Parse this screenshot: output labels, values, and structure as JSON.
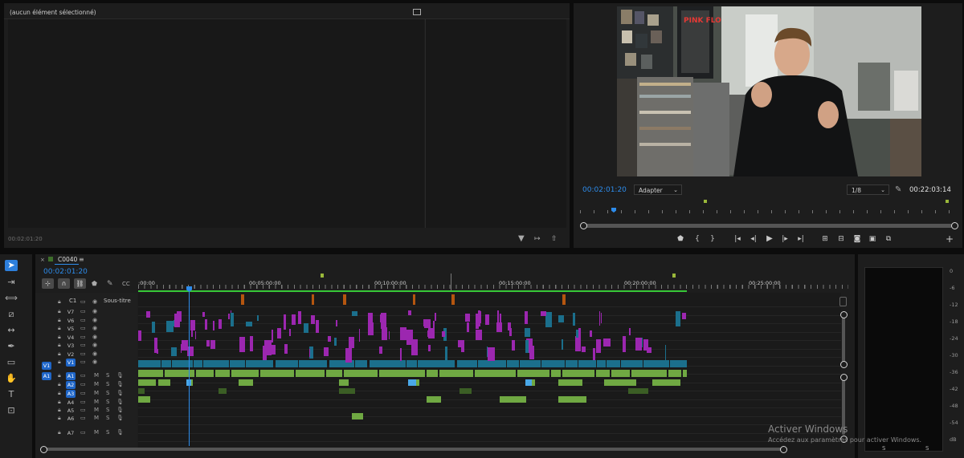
{
  "effect_controls": {
    "header": "(aucun élément sélectionné)",
    "footer_time": "00:02:01:20"
  },
  "program_monitor": {
    "current_time": "00:02:01:20",
    "zoom_select": "Adapter",
    "resolution_select": "1/8",
    "duration": "00:22:03:14",
    "controls": [
      "marker-icon",
      "mark-in-icon",
      "mark-out-icon",
      "go-to-in-icon",
      "step-back-icon",
      "play-icon",
      "step-forward-icon",
      "go-to-out-icon",
      "lift-icon",
      "extract-icon",
      "export-frame-icon",
      "compare-icon",
      "add-icon"
    ]
  },
  "sequence": {
    "tab_name": "C0040",
    "current_time": "00:02:01:20",
    "ruler_labels": [
      ":00:00",
      "00:05:00:00",
      "00:10:00:00",
      "00:15:00:00",
      "00:20:00:00",
      "00:25:00:00"
    ],
    "caption_track": {
      "id": "C1",
      "name": "Sous-titre"
    },
    "video_tracks": [
      "V7",
      "V6",
      "V5",
      "V4",
      "V3",
      "V2",
      "V1"
    ],
    "audio_tracks": [
      "A1",
      "A2",
      "A3",
      "A4",
      "A5",
      "A6",
      "A7"
    ],
    "source_patch_video": "V1",
    "source_patch_audio": "A1",
    "mute_label": "M",
    "solo_label": "S"
  },
  "tools": [
    "selection-tool-icon",
    "track-select-tool-icon",
    "ripple-edit-tool-icon",
    "razor-tool-icon",
    "slip-tool-icon",
    "pen-tool-icon",
    "rectangle-tool-icon",
    "hand-tool-icon",
    "type-tool-icon",
    "caption-tool-icon"
  ],
  "audio_meter": {
    "scale": [
      "0",
      "-6",
      "-12",
      "-18",
      "-24",
      "-30",
      "-36",
      "-42",
      "-48",
      "-54",
      "dB"
    ],
    "solo_labels": [
      "S",
      "S"
    ]
  },
  "watermark": {
    "title": "Activer Windows",
    "subtitle": "Accédez aux paramètres pour activer Windows."
  },
  "colors": {
    "accent_blue": "#2d8ceb",
    "video_clip_magenta": "#9c27b0",
    "video_clip_teal": "#1b6f8c",
    "audio_clip_green": "#7fc24a",
    "caption_orange": "#b5560f",
    "playhead": "#2d8ceb",
    "work_area_green": "#37c837"
  }
}
